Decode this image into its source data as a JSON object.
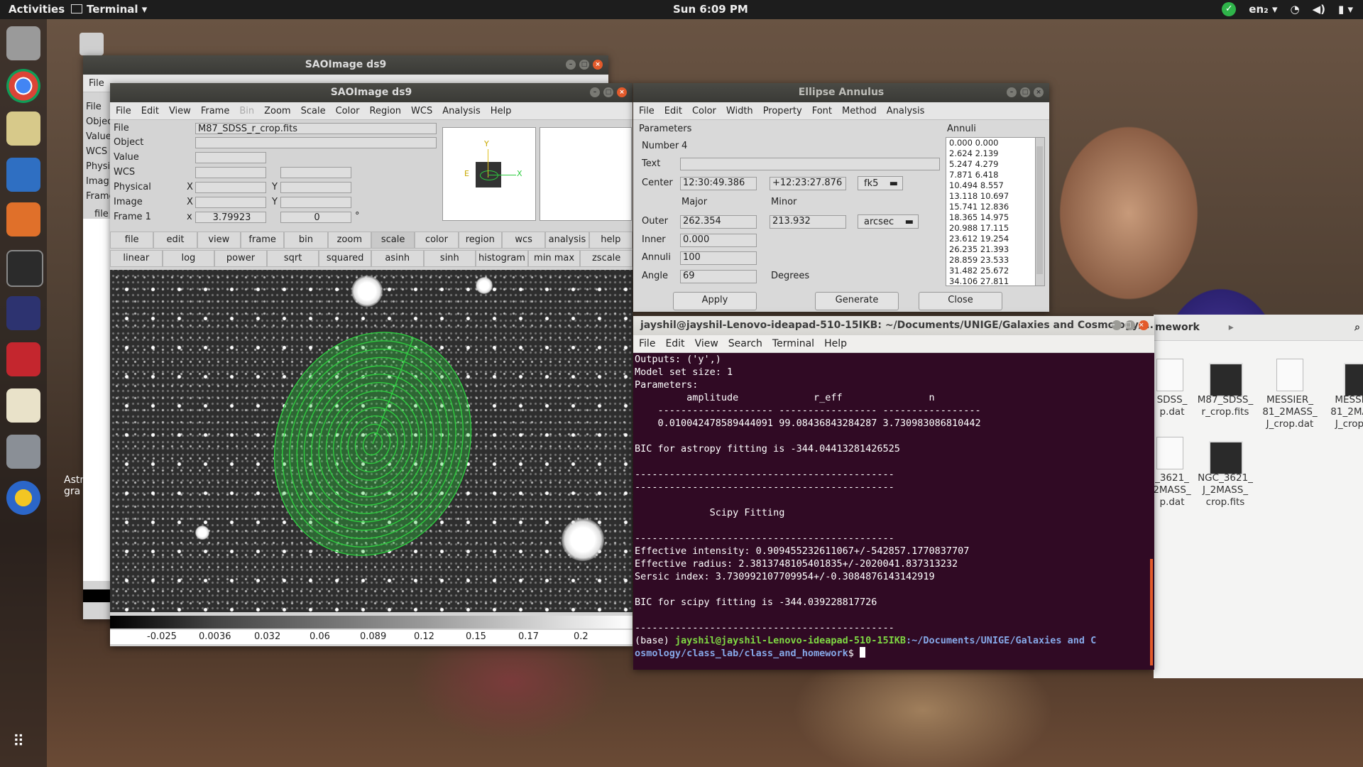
{
  "topbar": {
    "activities": "Activities",
    "app_menu": "Terminal",
    "clock": "Sun  6:09 PM",
    "lang": "en₂"
  },
  "ds9_back": {
    "title": "SAOImage ds9",
    "menu": [
      "File"
    ],
    "side_labels": [
      "File",
      "Objec",
      "Value",
      "WCS",
      "Physi",
      "Imag",
      "Frame",
      "file"
    ]
  },
  "ds9": {
    "title": "SAOImage ds9",
    "menu": [
      "File",
      "Edit",
      "View",
      "Frame",
      "Bin",
      "Zoom",
      "Scale",
      "Color",
      "Region",
      "WCS",
      "Analysis",
      "Help"
    ],
    "labels": {
      "file": "File",
      "object": "Object",
      "value": "Value",
      "wcs": "WCS",
      "physical": "Physical",
      "image": "Image",
      "frame": "Frame 1",
      "x": "X",
      "y": "Y",
      "xf": "x",
      "deg": "°"
    },
    "file_value": "M87_SDSS_r_crop.fits",
    "frame_zoom": "3.79923",
    "frame_angle": "0",
    "buttons1": [
      "file",
      "edit",
      "view",
      "frame",
      "bin",
      "zoom",
      "scale",
      "color",
      "region",
      "wcs",
      "analysis",
      "help"
    ],
    "buttons2": [
      "linear",
      "log",
      "power",
      "sqrt",
      "squared",
      "asinh",
      "sinh",
      "histogram",
      "min max",
      "zscale"
    ],
    "colorbar_ticks": [
      "-0.025",
      "0.0036",
      "0.032",
      "0.06",
      "0.089",
      "0.12",
      "0.15",
      "0.17",
      "0.2"
    ],
    "panner_axes": {
      "x": "X",
      "y": "Y",
      "e": "E"
    }
  },
  "ellipse": {
    "title": "Ellipse Annulus",
    "menu": [
      "File",
      "Edit",
      "Color",
      "Width",
      "Property",
      "Font",
      "Method",
      "Analysis"
    ],
    "parameters_label": "Parameters",
    "annuli_label": "Annuli",
    "number_label": "Number",
    "number": "4",
    "text_label": "Text",
    "text": "",
    "center_label": "Center",
    "center_ra": "12:30:49.386",
    "center_dec": "+12:23:27.876",
    "center_sys": "fk5",
    "major_label": "Major",
    "minor_label": "Minor",
    "outer_label": "Outer",
    "outer_major": "262.354",
    "outer_minor": "213.932",
    "outer_units": "arcsec",
    "inner_label": "Inner",
    "inner": "0.000",
    "annuli_count_label": "Annuli",
    "annuli_count": "100",
    "angle_label": "Angle",
    "angle": "69",
    "angle_units": "Degrees",
    "annuli_list": [
      "0.000 0.000",
      "2.624 2.139",
      "5.247 4.279",
      "7.871 6.418",
      "10.494 8.557",
      "13.118 10.697",
      "15.741 12.836",
      "18.365 14.975",
      "20.988 17.115",
      "23.612 19.254",
      "26.235 21.393",
      "28.859 23.533",
      "31.482 25.672",
      "34.106 27.811"
    ],
    "apply": "Apply",
    "generate": "Generate",
    "close": "Close"
  },
  "terminal": {
    "title": "jayshil@jayshil-Lenovo-ideapad-510-15IKB: ~/Documents/UNIGE/Galaxies and Cosmology/...",
    "menu": [
      "File",
      "Edit",
      "View",
      "Search",
      "Terminal",
      "Help"
    ],
    "lines": [
      "Outputs: ('y',)",
      "Model set size: 1",
      "Parameters:",
      "         amplitude             r_eff               n",
      "    -------------------- ----------------- -----------------",
      "    0.010042478589444091 99.08436843284287 3.730983086810442",
      "",
      "BIC for astropy fitting is -344.04413281426525",
      "",
      "---------------------------------------------",
      "---------------------------------------------",
      "",
      "             Scipy Fitting",
      "",
      "---------------------------------------------",
      "Effective intensity: 0.909455232611067+/-542857.1770837707",
      "Effective radius: 2.3813748105401835+/-2020041.837313232",
      "Sersic index: 3.730992107709954+/-0.3084876143142919",
      "",
      "BIC for scipy fitting is -344.039228817726",
      "",
      "---------------------------------------------"
    ],
    "prompt_prefix": "(base) ",
    "prompt_user": "jayshil@jayshil-Lenovo-ideapad-510-15IKB",
    "prompt_path1": ":~/Documents/UNIGE/Galaxies and C",
    "prompt_path2": "osmology/class_lab/class_and_homework",
    "prompt_end": "$ "
  },
  "filemanager": {
    "path_fragment": "mework",
    "files": [
      {
        "name": "SDSS_\np.dat"
      },
      {
        "name": "M87_SDSS_\nr_crop.fits"
      },
      {
        "name": "MESSIER_\n81_2MASS_\nJ_crop.dat"
      },
      {
        "name": "MESSI\n81_2MA\nJ_crop"
      },
      {
        "name": "_3621_\n2MASS_\np.dat"
      },
      {
        "name": "NGC_3621_\nJ_2MASS_\ncrop.fits"
      }
    ]
  },
  "desktop": {
    "label": "Astr\ngra"
  },
  "colors": {
    "topbar": "#1d1d1d",
    "terminal_bg": "#300a24",
    "prompt_green": "#7fd843",
    "prompt_blue": "#86a8e8",
    "region_green": "#2ecc40"
  }
}
